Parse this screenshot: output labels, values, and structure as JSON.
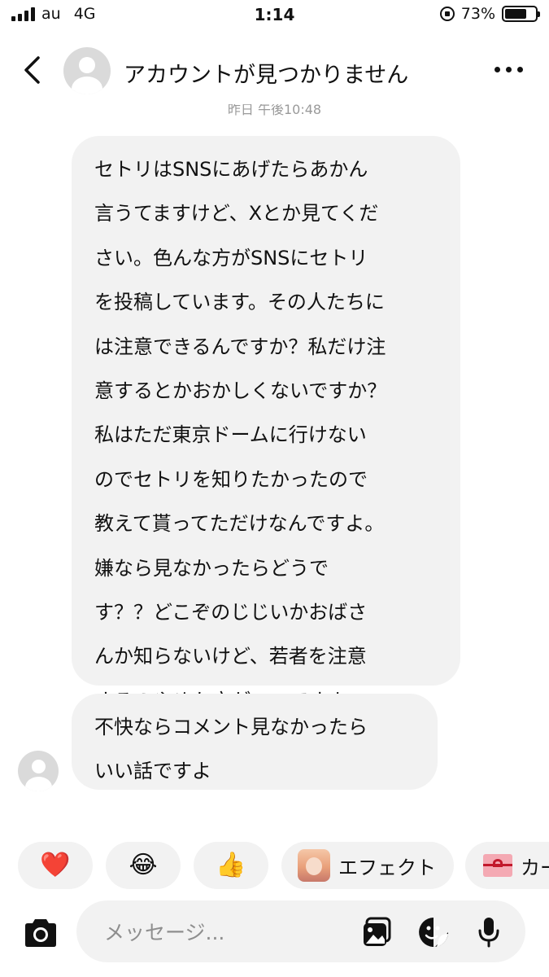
{
  "status_bar": {
    "carrier": "au",
    "network": "4G",
    "time": "1:14",
    "battery_percent": "73%",
    "battery_level": 0.73
  },
  "header": {
    "title": "アカウントが見つかりません",
    "back_icon": "chevron-left-icon",
    "more_icon": "more-horizontal-icon"
  },
  "conversation": {
    "timestamp": "昨日 午後10:48",
    "messages": [
      {
        "lines": [
          "セトリはSNSにあげたらあかん",
          "言うてますけど、Xとか見てくだ",
          "さい。色んな方がSNSにセトリ",
          "を投稿しています。その人たちに",
          "は注意できるんですか？私だけ注",
          "意するとかおかしくないですか？",
          "私はただ東京ドームに行けない",
          "のでセトリを知りたかったので",
          "教えて貰ってただけなんですよ。",
          "嫌なら見なかったらどうで",
          "す？？どこぞのじじいかおばさ",
          "んか知らないけど、若者を注意",
          "するのやめた方がいいですよ"
        ]
      },
      {
        "lines": [
          "不快ならコメント見なかったら",
          "いい話ですよ"
        ]
      }
    ]
  },
  "reactions": {
    "items": [
      {
        "emoji": "❤️",
        "icon": "heart-icon"
      },
      {
        "emoji": "😂",
        "icon": "tears-of-joy-icon"
      },
      {
        "emoji": "👍",
        "icon": "thumbs-up-icon"
      }
    ],
    "effect_label": "エフェクト",
    "card_label": "カード"
  },
  "composer": {
    "placeholder": "メッセージ...",
    "icons": [
      "camera-icon",
      "gallery-icon",
      "sticker-icon",
      "microphone-icon"
    ]
  },
  "colors": {
    "bubble": "#f2f2f2",
    "text": "#111111",
    "placeholder": "#8e8e8e",
    "background": "#ffffff"
  }
}
